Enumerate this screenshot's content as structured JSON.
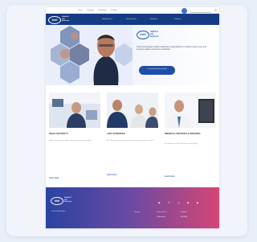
{
  "top_nav": {
    "items": [
      "Users",
      "Company",
      "Developers",
      "Partners"
    ],
    "search_placeholder": "Search",
    "search_icon": "search-icon",
    "menu_icon": "hamburger-icon"
  },
  "brand": {
    "logo": "intel",
    "sub": "Health & Life Sciences"
  },
  "blue_nav": {
    "items": [
      "Healthcare IT",
      "Life Sciences",
      "Solutions",
      "Partners"
    ]
  },
  "hero": {
    "text": "Intel technologies enable healthcare organizations to deliver better care and improve patient outcomes worldwide.",
    "cta": "Learn how Intel can help"
  },
  "cards": [
    {
      "title": "HEALTHCARE IT",
      "description": "Explore how Intel enables hospitals and care providers.",
      "link": "Learn more"
    },
    {
      "title": "LIFE SCIENCES",
      "description": "Accelerating research and discovery across the life sciences.",
      "link": "Learn more"
    },
    {
      "title": "MEDICAL DEVICES & IMAGING",
      "description": "Solutions for medical devices and imaging.",
      "link": "Learn more"
    }
  ],
  "footer": {
    "tagline": "© Intel Corporation",
    "social_icons": [
      "rss-icon",
      "twitter-icon",
      "instagram-icon",
      "facebook-icon",
      "youtube-icon"
    ],
    "links_row1": [
      "Privacy",
      "Terms of Use",
      "Cookies"
    ],
    "links_row2": [
      "Trademarks",
      "Site Map"
    ]
  },
  "colors": {
    "blue_bar": "#153c82",
    "accent": "#1f58b6",
    "footer_start": "#2a43a1",
    "footer_end": "#d64675"
  }
}
